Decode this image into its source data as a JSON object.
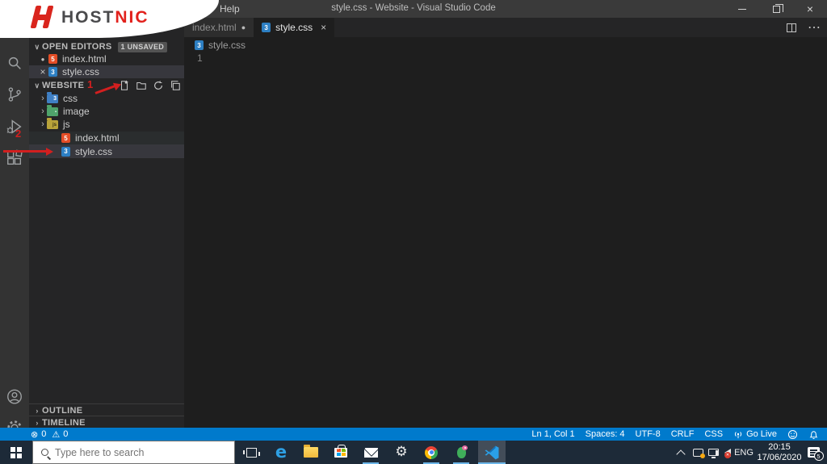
{
  "colors": {
    "statusbar_accent": "#007acc",
    "hostnic_red": "#e2211c",
    "annotation_red": "#d21f1f",
    "taskbar_bg": "#1d2a38",
    "editor_bg": "#1e1e1e",
    "sidebar_bg": "#252526",
    "activitybar_bg": "#333333",
    "html_icon_orange": "#e44d26",
    "css_icon_blue": "#2d7fc3"
  },
  "brand": {
    "host": "HOST",
    "nic": "NIC"
  },
  "title_bar": {
    "menu_help": "Help",
    "title": "style.css - Website - Visual Studio Code"
  },
  "tabs": {
    "tab1": {
      "label": "index.html"
    },
    "tab2": {
      "label": "style.css"
    }
  },
  "editor": {
    "breadcrumb_file": "style.css",
    "line1": "1"
  },
  "explorer": {
    "open_editors_label": "OPEN EDITORS",
    "unsaved_badge": "1 UNSAVED",
    "open_items": [
      {
        "label": "index.html"
      },
      {
        "label": "style.css"
      }
    ],
    "root_label": "WEBSITE",
    "tree": [
      {
        "label": "css"
      },
      {
        "label": "image"
      },
      {
        "label": "js"
      },
      {
        "label": "index.html"
      },
      {
        "label": "style.css"
      }
    ],
    "outline_label": "OUTLINE",
    "timeline_label": "TIMELINE"
  },
  "annotations": {
    "step1": "1",
    "step2": "2"
  },
  "status_bar": {
    "errors": "0",
    "warnings": "0",
    "cursor": "Ln 1, Col 1",
    "indent": "Spaces: 4",
    "encoding": "UTF-8",
    "eol": "CRLF",
    "language": "CSS",
    "go_live": "Go Live"
  },
  "taskbar": {
    "search_placeholder": "Type here to search",
    "lang": "ENG",
    "time": "20:15",
    "date": "17/06/2020",
    "notif_count": "5"
  },
  "glyphs": {
    "chevron_down": "∨",
    "chevron_right": "›",
    "dot": "●",
    "close": "×",
    "more": "⋯",
    "error": "⊗",
    "warning": "⚠",
    "gear": "⚙",
    "edge_e": "e"
  }
}
